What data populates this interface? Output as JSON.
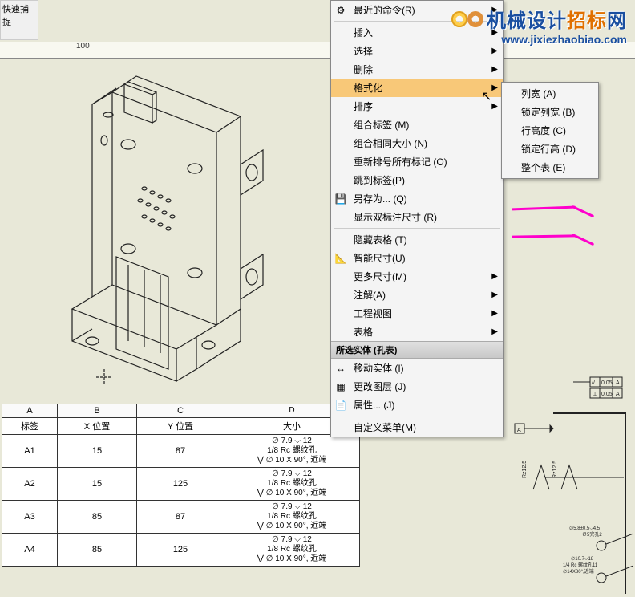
{
  "toolbar": {
    "quick_snap": "快速捕捉"
  },
  "ruler": {
    "tick100": "100"
  },
  "context_menu": {
    "recent": "最近的命令(R)",
    "insert": "插入",
    "select": "选择",
    "delete": "删除",
    "format": "格式化",
    "sort": "排序",
    "merge_label": "组合标签 (M)",
    "merge_size": "组合相同大小 (N)",
    "renumber": "重新排号所有标记 (O)",
    "jump": "跳到标签(P)",
    "saveas": "另存为... (Q)",
    "show_dual": "显示双标注尺寸 (R)",
    "hide_table": "隐藏表格 (T)",
    "smart_dim": "智能尺寸(U)",
    "more_dim": "更多尺寸(M)",
    "annotation": "注解(A)",
    "drawing_view": "工程视图",
    "tables": "表格",
    "section": "所选实体 (孔表)",
    "move_entity": "移动实体 (I)",
    "change_layer": "更改图层 (J)",
    "properties": "属性... (J)",
    "custom_menu": "自定义菜单(M)"
  },
  "submenu": {
    "col_width": "列宽 (A)",
    "lock_col_width": "锁定列宽 (B)",
    "row_height": "行高度 (C)",
    "lock_row_height": "锁定行高 (D)",
    "whole_table": "整个表 (E)"
  },
  "watermark": {
    "line1_a": "机械设计",
    "line1_b": "招标",
    "line1_c": "网",
    "line2": "www.jixiezhaobiao.com"
  },
  "table": {
    "headers": {
      "a": "A",
      "b": "B",
      "c": "C",
      "d": "D"
    },
    "subheaders": {
      "a": "标签",
      "b": "X 位置",
      "c": "Y 位置",
      "d": "大小"
    },
    "rows": [
      {
        "tag": "A1",
        "x": "15",
        "y": "87",
        "d1": "∅ 7.9 ⌵ 12",
        "d2": "1/8 Rc 螺纹孔",
        "d3": "⋁ ∅ 10 X 90°, 近端"
      },
      {
        "tag": "A2",
        "x": "15",
        "y": "125",
        "d1": "∅ 7.9 ⌵ 12",
        "d2": "1/8 Rc 螺纹孔",
        "d3": "⋁ ∅ 10 X 90°, 近端"
      },
      {
        "tag": "A3",
        "x": "85",
        "y": "87",
        "d1": "∅ 7.9 ⌵ 12",
        "d2": "1/8 Rc 螺纹孔",
        "d3": "⋁ ∅ 10 X 90°, 近端"
      },
      {
        "tag": "A4",
        "x": "85",
        "y": "125",
        "d1": "∅ 7.9 ⌵ 12",
        "d2": "1/8 Rc 螺纹孔",
        "d3": "⋁ ∅ 10 X 90°, 近端"
      }
    ]
  },
  "drawing_right": {
    "tol1": "// 0.05 A",
    "tol2": "⊥ 0.05 A",
    "datum": "A",
    "ra": "Rz12.5",
    "note1": "∅ 5.8 ± 0.5 ⌵ 4.5",
    "note2": "∅5完孔2",
    "note3": "∅ 10.7 ⌵ 18",
    "note4": "1/4 Rc 螺纹孔 11",
    "note5": "∅ 14 X 80°, 近端"
  }
}
